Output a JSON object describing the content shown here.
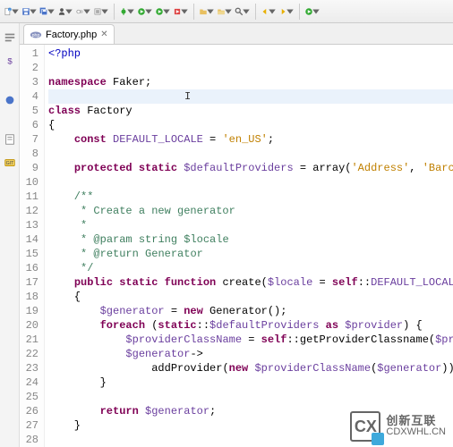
{
  "toolbar_icons": [
    "new-file-icon",
    "save-icon",
    "save-all-icon",
    "user-icon",
    "toggle-icon",
    "build-icon",
    "sep",
    "debug-icon",
    "run-icon",
    "run-ext-icon",
    "ext-tool-icon",
    "sep",
    "new-folder-icon",
    "open-folder-icon",
    "search-icon",
    "sep",
    "nav-back-icon",
    "nav-fwd-icon",
    "sep",
    "launch-icon"
  ],
  "gutter_icons": [
    "outline-icon",
    "vars-icon",
    "sep",
    "breakpoint-icon",
    "sep",
    "tasks-icon",
    "git-icon"
  ],
  "tab": {
    "filename": "Factory.php"
  },
  "code": {
    "lines": [
      {
        "n": 1,
        "segs": [
          {
            "t": "<?php",
            "c": "kw2"
          }
        ]
      },
      {
        "n": 2,
        "segs": []
      },
      {
        "n": 3,
        "segs": [
          {
            "t": "namespace ",
            "c": "kw"
          },
          {
            "t": "Faker",
            "c": "type"
          },
          {
            "t": ";",
            "c": "op"
          }
        ]
      },
      {
        "n": 4,
        "segs": [],
        "hl": true,
        "cursor": true
      },
      {
        "n": 5,
        "segs": [
          {
            "t": "class ",
            "c": "kw"
          },
          {
            "t": "Factory",
            "c": "type"
          }
        ]
      },
      {
        "n": 6,
        "segs": [
          {
            "t": "{",
            "c": "op"
          }
        ]
      },
      {
        "n": 7,
        "segs": [
          {
            "t": "    ",
            "c": ""
          },
          {
            "t": "const ",
            "c": "kw"
          },
          {
            "t": "DEFAULT_LOCALE",
            "c": "var"
          },
          {
            "t": " = ",
            "c": "op"
          },
          {
            "t": "'en_US'",
            "c": "str"
          },
          {
            "t": ";",
            "c": "op"
          }
        ]
      },
      {
        "n": 8,
        "segs": []
      },
      {
        "n": 9,
        "segs": [
          {
            "t": "    ",
            "c": ""
          },
          {
            "t": "protected static ",
            "c": "kw"
          },
          {
            "t": "$defaultProviders",
            "c": "var"
          },
          {
            "t": " = ",
            "c": "op"
          },
          {
            "t": "array",
            "c": "fn"
          },
          {
            "t": "(",
            "c": "op"
          },
          {
            "t": "'Address'",
            "c": "str"
          },
          {
            "t": ", ",
            "c": "op"
          },
          {
            "t": "'Barc",
            "c": "str"
          }
        ]
      },
      {
        "n": 10,
        "segs": []
      },
      {
        "n": 11,
        "segs": [
          {
            "t": "    /**",
            "c": "cm"
          }
        ]
      },
      {
        "n": 12,
        "segs": [
          {
            "t": "     * Create a new generator",
            "c": "cm"
          }
        ]
      },
      {
        "n": 13,
        "segs": [
          {
            "t": "     *",
            "c": "cm"
          }
        ]
      },
      {
        "n": 14,
        "segs": [
          {
            "t": "     * ",
            "c": "cm"
          },
          {
            "t": "@param",
            "c": "tag"
          },
          {
            "t": " string $locale",
            "c": "cm"
          }
        ]
      },
      {
        "n": 15,
        "segs": [
          {
            "t": "     * ",
            "c": "cm"
          },
          {
            "t": "@return",
            "c": "tag"
          },
          {
            "t": " Generator",
            "c": "cm"
          }
        ]
      },
      {
        "n": 16,
        "segs": [
          {
            "t": "     */",
            "c": "cm"
          }
        ]
      },
      {
        "n": 17,
        "segs": [
          {
            "t": "    ",
            "c": ""
          },
          {
            "t": "public static function ",
            "c": "kw"
          },
          {
            "t": "create",
            "c": "fn"
          },
          {
            "t": "(",
            "c": "op"
          },
          {
            "t": "$locale",
            "c": "var"
          },
          {
            "t": " = ",
            "c": "op"
          },
          {
            "t": "self",
            "c": "kw"
          },
          {
            "t": "::",
            "c": "op"
          },
          {
            "t": "DEFAULT_LOCAL",
            "c": "var"
          }
        ]
      },
      {
        "n": 18,
        "segs": [
          {
            "t": "    {",
            "c": "op"
          }
        ]
      },
      {
        "n": 19,
        "segs": [
          {
            "t": "        ",
            "c": ""
          },
          {
            "t": "$generator",
            "c": "var"
          },
          {
            "t": " = ",
            "c": "op"
          },
          {
            "t": "new ",
            "c": "kw"
          },
          {
            "t": "Generator",
            "c": "type"
          },
          {
            "t": "();",
            "c": "op"
          }
        ]
      },
      {
        "n": 20,
        "segs": [
          {
            "t": "        ",
            "c": ""
          },
          {
            "t": "foreach ",
            "c": "kw"
          },
          {
            "t": "(",
            "c": "op"
          },
          {
            "t": "static",
            "c": "kw"
          },
          {
            "t": "::",
            "c": "op"
          },
          {
            "t": "$defaultProviders",
            "c": "var"
          },
          {
            "t": " as ",
            "c": "kw"
          },
          {
            "t": "$provider",
            "c": "var"
          },
          {
            "t": ") {",
            "c": "op"
          }
        ]
      },
      {
        "n": 21,
        "segs": [
          {
            "t": "            ",
            "c": ""
          },
          {
            "t": "$providerClassName",
            "c": "var"
          },
          {
            "t": " = ",
            "c": "op"
          },
          {
            "t": "self",
            "c": "kw"
          },
          {
            "t": "::",
            "c": "op"
          },
          {
            "t": "getProviderClassname",
            "c": "fn"
          },
          {
            "t": "(",
            "c": "op"
          },
          {
            "t": "$pr",
            "c": "var"
          }
        ]
      },
      {
        "n": 22,
        "segs": [
          {
            "t": "            ",
            "c": ""
          },
          {
            "t": "$generator",
            "c": "var"
          },
          {
            "t": "->",
            "c": "op"
          }
        ]
      },
      {
        "n": 23,
        "segs": [
          {
            "t": "                ",
            "c": ""
          },
          {
            "t": "addProvider",
            "c": "fn"
          },
          {
            "t": "(",
            "c": "op"
          },
          {
            "t": "new ",
            "c": "kw"
          },
          {
            "t": "$providerClassName",
            "c": "var"
          },
          {
            "t": "(",
            "c": "op"
          },
          {
            "t": "$generator",
            "c": "var"
          },
          {
            "t": "))",
            "c": "op"
          }
        ]
      },
      {
        "n": 24,
        "segs": [
          {
            "t": "        }",
            "c": "op"
          }
        ]
      },
      {
        "n": 25,
        "segs": []
      },
      {
        "n": 26,
        "segs": [
          {
            "t": "        ",
            "c": ""
          },
          {
            "t": "return ",
            "c": "kw"
          },
          {
            "t": "$generator",
            "c": "var"
          },
          {
            "t": ";",
            "c": "op"
          }
        ]
      },
      {
        "n": 27,
        "segs": [
          {
            "t": "    }",
            "c": "op"
          }
        ]
      },
      {
        "n": 28,
        "segs": []
      }
    ]
  },
  "watermark": {
    "brand": "创新互联",
    "sub": "CDXWHL.CN"
  }
}
